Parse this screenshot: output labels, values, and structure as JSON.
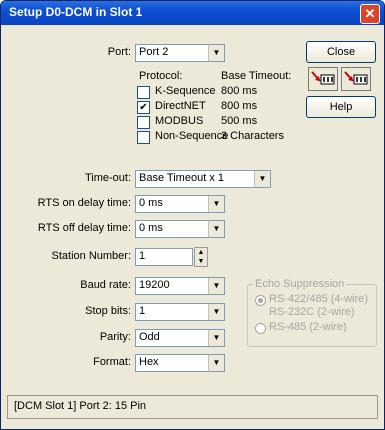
{
  "window": {
    "title": "Setup D0-DCM in Slot 1",
    "close_glyph": "✕"
  },
  "port": {
    "label": "Port:",
    "value": "Port 2"
  },
  "buttons": {
    "close": "Close",
    "help": "Help"
  },
  "protocol": {
    "header": "Protocol:",
    "timeout_header": "Base Timeout:",
    "items": [
      {
        "label": "K-Sequence",
        "checked": false,
        "timeout": "800 ms"
      },
      {
        "label": "DirectNET",
        "checked": true,
        "timeout": "800 ms"
      },
      {
        "label": "MODBUS",
        "checked": false,
        "timeout": "500 ms"
      },
      {
        "label": "Non-Sequence",
        "checked": false,
        "timeout": "3 Characters"
      }
    ]
  },
  "fields": {
    "timeout": {
      "label": "Time-out:",
      "value": "Base Timeout x 1"
    },
    "rts_on": {
      "label": "RTS on delay time:",
      "value": "0 ms"
    },
    "rts_off": {
      "label": "RTS off delay time:",
      "value": "0 ms"
    },
    "station": {
      "label": "Station Number:",
      "value": "1"
    },
    "baud": {
      "label": "Baud rate:",
      "value": "19200"
    },
    "stop": {
      "label": "Stop bits:",
      "value": "1"
    },
    "parity": {
      "label": "Parity:",
      "value": "Odd"
    },
    "format": {
      "label": "Format:",
      "value": "Hex"
    }
  },
  "echo": {
    "title": "Echo Suppression",
    "options": [
      {
        "line1": "RS-422/485 (4-wire)",
        "line2": "RS-232C (2-wire)",
        "selected": true
      },
      {
        "line1": "RS-485 (2-wire)",
        "selected": false
      }
    ]
  },
  "status": "[DCM Slot 1] Port 2: 15 Pin"
}
